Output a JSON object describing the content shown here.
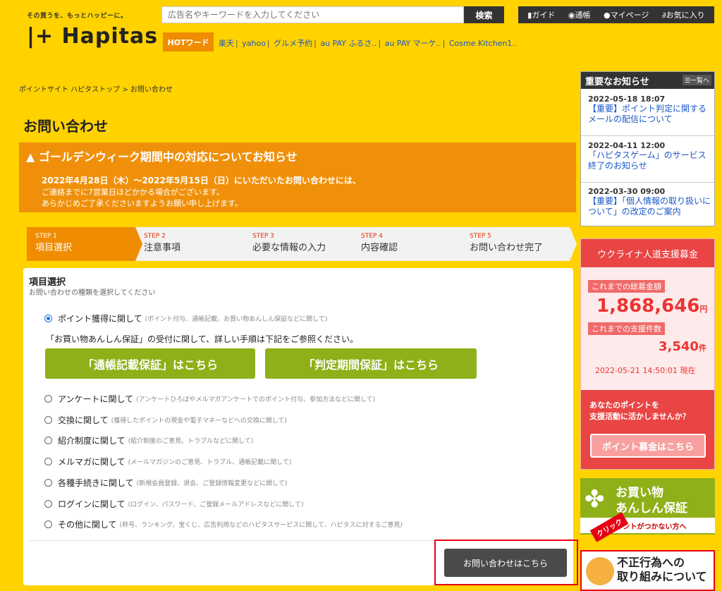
{
  "header": {
    "tagline": "その買うを、もっとハッピーに。",
    "logo": "|+ Hapitas",
    "search_placeholder": "広告名やキーワードを入力してください",
    "search_button": "検索",
    "tools": [
      "ガイド",
      "通帳",
      "マイページ",
      "お気に入り"
    ],
    "hot_label": "HOTワード",
    "hot_links": [
      "楽天",
      "yahoo",
      "グルメ予約",
      "au PAY ふるさ..",
      "au PAY マーケ..",
      "Cosme Kitchen1.."
    ]
  },
  "breadcrumb": "ポイントサイト ハピタストップ > お問い合わせ",
  "page_title": "お問い合わせ",
  "notice": {
    "heading": "ゴールデンウィーク期間中の対応についてお知らせ",
    "line1": "2022年4月28日（木）～2022年5月15日（日）にいただいたお問い合わせには、",
    "line2": "ご連絡までに7営業日ほどかかる場合がございます。",
    "line3": "あらかじめご了承くださいますようお願い申し上げます。"
  },
  "steps": [
    {
      "num": "STEP 1",
      "label": "項目選択"
    },
    {
      "num": "STEP 2",
      "label": "注意事項"
    },
    {
      "num": "STEP 3",
      "label": "必要な情報の入力"
    },
    {
      "num": "STEP 4",
      "label": "内容確認"
    },
    {
      "num": "STEP 5",
      "label": "お問い合わせ完了"
    }
  ],
  "panel": {
    "heading": "項目選択",
    "sub": "お問い合わせの種類を選択してください",
    "guide": "「お買い物あんしん保証」の受付に関して、詳しい手順は下記をご参照ください。",
    "btn1": "「通帳記載保証」はこちら",
    "btn2": "「判定期間保証」はこちら",
    "options": [
      {
        "label": "ポイント獲得に関して",
        "desc": "(ポイント付与、通帳記載、お買い物あんしん保証などに関して)"
      },
      {
        "label": "アンケートに関して",
        "desc": "(アンケートひろばやメルマガアンケートでのポイント付与、参加方法などに関して)"
      },
      {
        "label": "交換に関して",
        "desc": "(獲得したポイントの現金や電子マネーなどへの交換に関して)"
      },
      {
        "label": "紹介制度に関して",
        "desc": "(紹介制度のご意見、トラブルなどに関して)"
      },
      {
        "label": "メルマガに関して",
        "desc": "(メールマガジンのご意見、トラブル、通帳記載に関して)"
      },
      {
        "label": "各種手続きに関して",
        "desc": "(新規会員登録、退会、ご登録情報変更などに関して)"
      },
      {
        "label": "ログインに関して",
        "desc": "(ログイン、パスワード、ご登録メールアドレスなどに関して)"
      },
      {
        "label": "その他に関して",
        "desc": "(称号、ランキング、宝くじ、広告利用などのハピタスサービスに関して、ハピタスに対するご意見)"
      }
    ],
    "submit": "お問い合わせはこちら"
  },
  "news": {
    "heading": "重要なお知らせ",
    "all": "一覧へ",
    "items": [
      {
        "date": "2022-05-18 18:07",
        "text": "【重要】ポイント判定に関するメールの配信について"
      },
      {
        "date": "2022-04-11 12:00",
        "text": "「ハピタスゲーム」のサービス終了のお知らせ"
      },
      {
        "date": "2022-03-30 09:00",
        "text": "【重要】「個人情報の取り扱いについて」の改定のご案内"
      }
    ]
  },
  "ukraine": {
    "heading": "ウクライナ人道支援募金",
    "total_label": "これまでの総募金額",
    "total": "1,868,646",
    "total_unit": "円分",
    "count_label": "これまでの支援件数",
    "count": "3,540",
    "count_unit": "件",
    "datetime": "2022-05-21 14:50:01 現在",
    "cta1": "あなたのポイントを",
    "cta2": "支援活動に活かしませんか？",
    "cta_btn": "ポイント募金はこちら"
  },
  "safe": {
    "t1": "お買い物",
    "t2": "あんしん保証",
    "t3": "ポイントがつかない方へ"
  },
  "click": "クリック",
  "fusei": {
    "t1": "不正行為への",
    "t2": "取り組みについて"
  }
}
